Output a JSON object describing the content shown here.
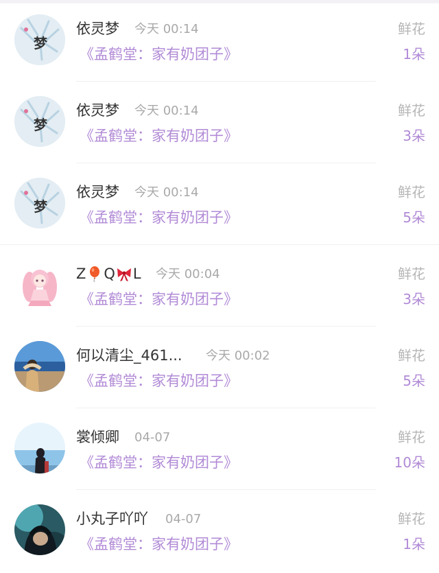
{
  "gifts": [
    {
      "user": "依灵梦",
      "time": "今天 00:14",
      "book": "《孟鹤堂：家有奶团子》",
      "gift": "鲜花",
      "count": "1朵",
      "avatar": "dream-avatar-icon"
    },
    {
      "user": "依灵梦",
      "time": "今天 00:14",
      "book": "《孟鹤堂：家有奶团子》",
      "gift": "鲜花",
      "count": "3朵",
      "avatar": "dream-avatar-icon"
    },
    {
      "user": "依灵梦",
      "time": "今天 00:14",
      "book": "《孟鹤堂：家有奶团子》",
      "gift": "鲜花",
      "count": "5朵",
      "avatar": "dream-avatar-icon"
    },
    {
      "user_parts": [
        "Z",
        "Q",
        "L"
      ],
      "time": "今天 00:04",
      "book": "《孟鹤堂：家有奶团子》",
      "gift": "鲜花",
      "count": "3朵",
      "avatar": "anime-girl-avatar-icon"
    },
    {
      "user": "何以清尘_461...",
      "time": "今天 00:02",
      "book": "《孟鹤堂：家有奶团子》",
      "gift": "鲜花",
      "count": "5朵",
      "avatar": "beach-photo-avatar-icon"
    },
    {
      "user": "裳倾卿",
      "time": "04-07",
      "book": "《孟鹤堂：家有奶团子》",
      "gift": "鲜花",
      "count": "10朵",
      "avatar": "sea-silhouette-avatar-icon"
    },
    {
      "user": "小丸子吖吖",
      "time": "04-07",
      "book": "《孟鹤堂：家有奶团子》",
      "gift": "鲜花",
      "count": "1朵",
      "avatar": "hooded-figure-avatar-icon"
    }
  ]
}
